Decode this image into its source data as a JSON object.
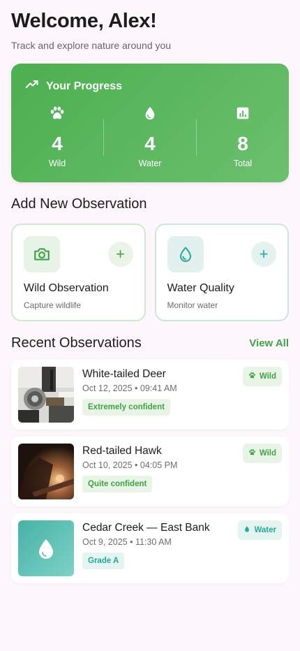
{
  "header": {
    "title": "Welcome, Alex!",
    "subtitle": "Track and explore nature around you"
  },
  "progress": {
    "title": "Your Progress",
    "icon": "trending-up-icon",
    "stats": [
      {
        "icon": "paw-icon",
        "value": "4",
        "label": "Wild"
      },
      {
        "icon": "water-drop-icon",
        "value": "4",
        "label": "Water"
      },
      {
        "icon": "bar-chart-icon",
        "value": "8",
        "label": "Total"
      }
    ]
  },
  "add_section": {
    "title": "Add New Observation",
    "cards": [
      {
        "title": "Wild Observation",
        "subtitle": "Capture wildlife",
        "icon": "camera-icon",
        "plus": "+"
      },
      {
        "title": "Water Quality",
        "subtitle": "Monitor water",
        "icon": "water-drop-icon",
        "plus": "+"
      }
    ]
  },
  "recent": {
    "title": "Recent Observations",
    "view_all": "View All",
    "items": [
      {
        "name": "White-tailed Deer",
        "date": "Oct 12, 2025 • 09:41 AM",
        "tag": "Extremely confident",
        "badge": "Wild"
      },
      {
        "name": "Red-tailed Hawk",
        "date": "Oct 10, 2025 • 04:05 PM",
        "tag": "Quite confident",
        "badge": "Wild"
      },
      {
        "name": "Cedar Creek — East Bank",
        "date": "Oct 9, 2025 • 11:30 AM",
        "tag": "Grade A",
        "badge": "Water"
      }
    ]
  },
  "colors": {
    "primary_green": "#4caf50",
    "teal": "#26a69a",
    "background": "#fdf7fb"
  }
}
